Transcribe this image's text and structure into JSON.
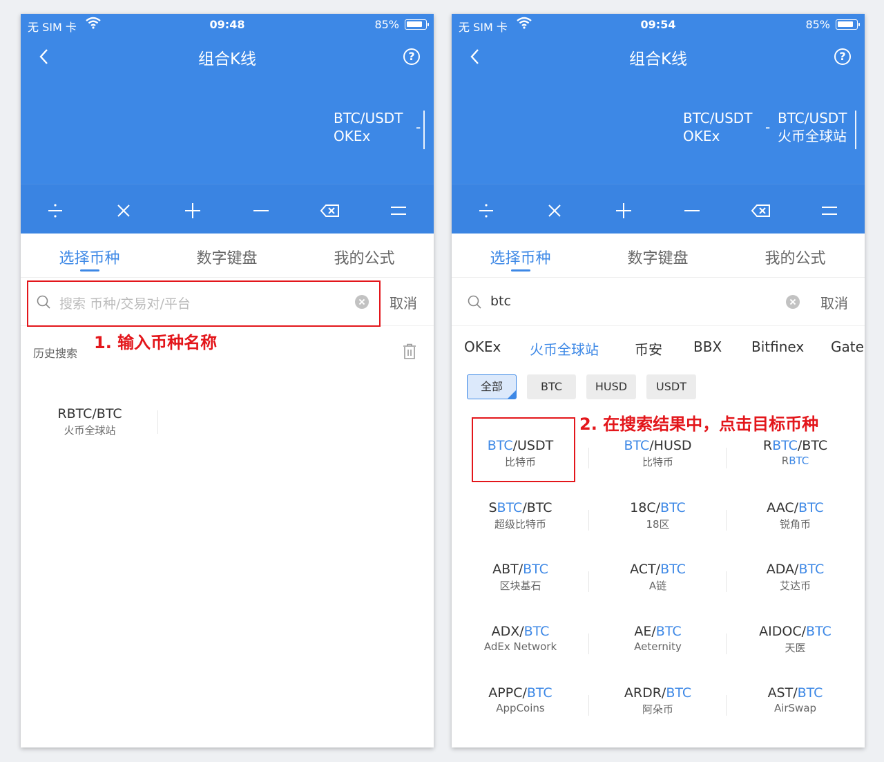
{
  "status": {
    "left": {
      "carrier": "无 SIM 卡",
      "time": "09:48",
      "battery": "85%"
    },
    "right": {
      "carrier": "无 SIM 卡",
      "time": "09:54",
      "battery": "85%"
    },
    "battery_level": 0.85
  },
  "nav": {
    "title": "组合K线",
    "help": "?"
  },
  "formula": {
    "left_items": [
      {
        "pair": "BTC/USDT",
        "exchange": "OKEx"
      }
    ],
    "right_items": [
      {
        "pair": "BTC/USDT",
        "exchange": "OKEx"
      },
      {
        "pair": "BTC/USDT",
        "exchange": "火币全球站"
      }
    ],
    "operator": "-"
  },
  "operators": [
    "divide",
    "multiply",
    "plus",
    "minus",
    "backspace",
    "equals"
  ],
  "tabs": [
    "选择币种",
    "数字键盘",
    "我的公式"
  ],
  "search": {
    "placeholder": "搜索 币种/交易对/平台",
    "value": "btc",
    "cancel": "取消"
  },
  "annotations": {
    "step1": "1. 输入币种名称",
    "step2": "2. 在搜索结果中，点击目标币种"
  },
  "history": {
    "label": "历史搜索",
    "items": [
      {
        "pair": "RBTC/BTC",
        "exchange": "火币全球站"
      }
    ]
  },
  "exchanges": [
    "OKEx",
    "火币全球站",
    "币安",
    "BBX",
    "Bitfinex",
    "Gate"
  ],
  "active_exchange": 1,
  "quote_filters": [
    "全部",
    "BTC",
    "HUSD",
    "USDT"
  ],
  "active_filter": 0,
  "results": [
    {
      "pre": "",
      "hl": "BTC",
      "post": "/USDT",
      "sub_pre": "",
      "sub_hl": "",
      "sub_post": "比特币"
    },
    {
      "pre": "",
      "hl": "BTC",
      "post": "/HUSD",
      "sub_pre": "",
      "sub_hl": "",
      "sub_post": "比特币"
    },
    {
      "pre": "R",
      "hl": "BTC",
      "post": "/BTC",
      "sub_pre": "R",
      "sub_hl": "BTC",
      "sub_post": ""
    },
    {
      "pre": "S",
      "hl": "BTC",
      "post": "/BTC",
      "sub_pre": "",
      "sub_hl": "",
      "sub_post": "超级比特币"
    },
    {
      "pre": "18C/",
      "hl": "BTC",
      "post": "",
      "sub_pre": "",
      "sub_hl": "",
      "sub_post": "18区"
    },
    {
      "pre": "AAC/",
      "hl": "BTC",
      "post": "",
      "sub_pre": "",
      "sub_hl": "",
      "sub_post": "锐角币"
    },
    {
      "pre": "ABT/",
      "hl": "BTC",
      "post": "",
      "sub_pre": "",
      "sub_hl": "",
      "sub_post": "区块基石"
    },
    {
      "pre": "ACT/",
      "hl": "BTC",
      "post": "",
      "sub_pre": "",
      "sub_hl": "",
      "sub_post": "A链"
    },
    {
      "pre": "ADA/",
      "hl": "BTC",
      "post": "",
      "sub_pre": "",
      "sub_hl": "",
      "sub_post": "艾达币"
    },
    {
      "pre": "ADX/",
      "hl": "BTC",
      "post": "",
      "sub_pre": "",
      "sub_hl": "",
      "sub_post": "AdEx Network"
    },
    {
      "pre": "AE/",
      "hl": "BTC",
      "post": "",
      "sub_pre": "",
      "sub_hl": "",
      "sub_post": "Aeternity"
    },
    {
      "pre": "AIDOC/",
      "hl": "BTC",
      "post": "",
      "sub_pre": "",
      "sub_hl": "",
      "sub_post": "天医"
    },
    {
      "pre": "APPC/",
      "hl": "BTC",
      "post": "",
      "sub_pre": "",
      "sub_hl": "",
      "sub_post": "AppCoins"
    },
    {
      "pre": "ARDR/",
      "hl": "BTC",
      "post": "",
      "sub_pre": "",
      "sub_hl": "",
      "sub_post": "阿朵币"
    },
    {
      "pre": "AST/",
      "hl": "BTC",
      "post": "",
      "sub_pre": "",
      "sub_hl": "",
      "sub_post": "AirSwap"
    }
  ],
  "colors": {
    "primary": "#3d88e6",
    "annotation": "#e3161b",
    "text": "#333333",
    "muted": "#666666"
  }
}
